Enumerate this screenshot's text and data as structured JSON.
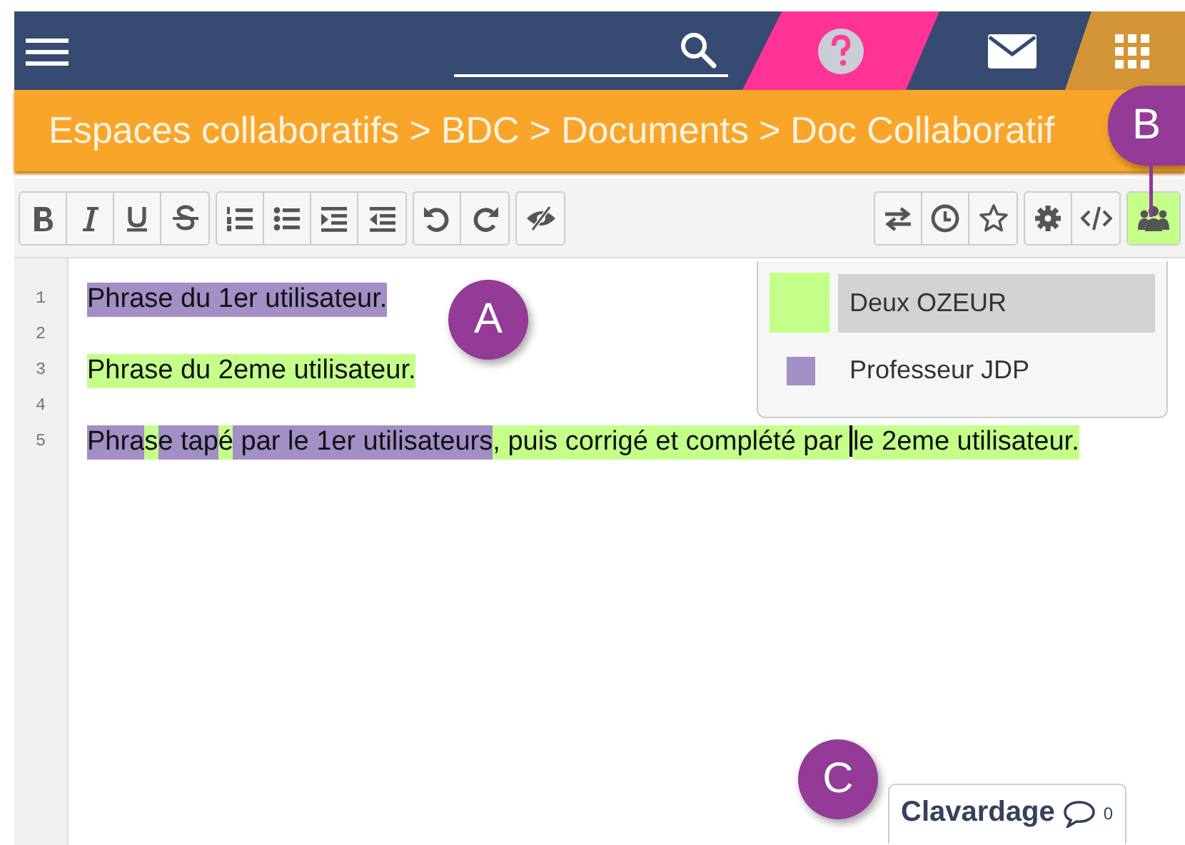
{
  "breadcrumb": [
    "Espaces collaboratifs",
    "BDC",
    "Documents",
    "Doc Collaboratif"
  ],
  "breadcrumb_separator": ">",
  "toolbar_left": [
    {
      "buttons": [
        {
          "kind": "bold"
        },
        {
          "kind": "italic"
        },
        {
          "kind": "underline"
        },
        {
          "kind": "strike"
        }
      ]
    },
    {
      "buttons": [
        {
          "kind": "ordered-list"
        },
        {
          "kind": "bullet-list"
        },
        {
          "kind": "indent"
        },
        {
          "kind": "outdent"
        }
      ]
    },
    {
      "buttons": [
        {
          "kind": "undo"
        },
        {
          "kind": "redo"
        }
      ]
    },
    {
      "buttons": [
        {
          "kind": "hide"
        }
      ]
    }
  ],
  "toolbar_right": [
    {
      "buttons": [
        {
          "kind": "swap"
        },
        {
          "kind": "history"
        },
        {
          "kind": "star"
        }
      ]
    },
    {
      "buttons": [
        {
          "kind": "settings"
        },
        {
          "kind": "code"
        }
      ]
    },
    {
      "buttons": [
        {
          "kind": "users"
        }
      ]
    }
  ],
  "users": [
    {
      "name": "Deux OZEUR",
      "color": "#c4ff8a",
      "selected": true
    },
    {
      "name": "Professeur JDP",
      "color": "#a18fc6",
      "selected": false
    }
  ],
  "lines": [
    {
      "number": "1",
      "runs": [
        {
          "text": "Phrase du 1er utilisateur.",
          "color": "#a18fc6"
        }
      ]
    },
    {
      "number": "2"
    },
    {
      "number": "3",
      "runs": [
        {
          "text": "Phrase du 2eme utilisateur.",
          "color": "#c4ff8a"
        }
      ]
    },
    {
      "number": "4"
    },
    {
      "number": "5",
      "runs": [
        {
          "text": "Phra",
          "color": "#a18fc6"
        },
        {
          "text": "s",
          "color": "#c4ff8a"
        },
        {
          "text": "e tap",
          "color": "#a18fc6"
        },
        {
          "text": "é",
          "color": "#c4ff8a"
        },
        {
          "text": " par le 1er utilisateurs",
          "color": "#a18fc6"
        },
        {
          "text": ", puis corrigé et complété par ",
          "color": "#c4ff8a",
          "cursor_after": true
        },
        {
          "text": "le 2eme utilisateur.",
          "color": "#c4ff8a"
        }
      ]
    }
  ],
  "chat": {
    "label": "Clavardage",
    "count": "0"
  },
  "callouts": [
    "A",
    "B",
    "C"
  ]
}
